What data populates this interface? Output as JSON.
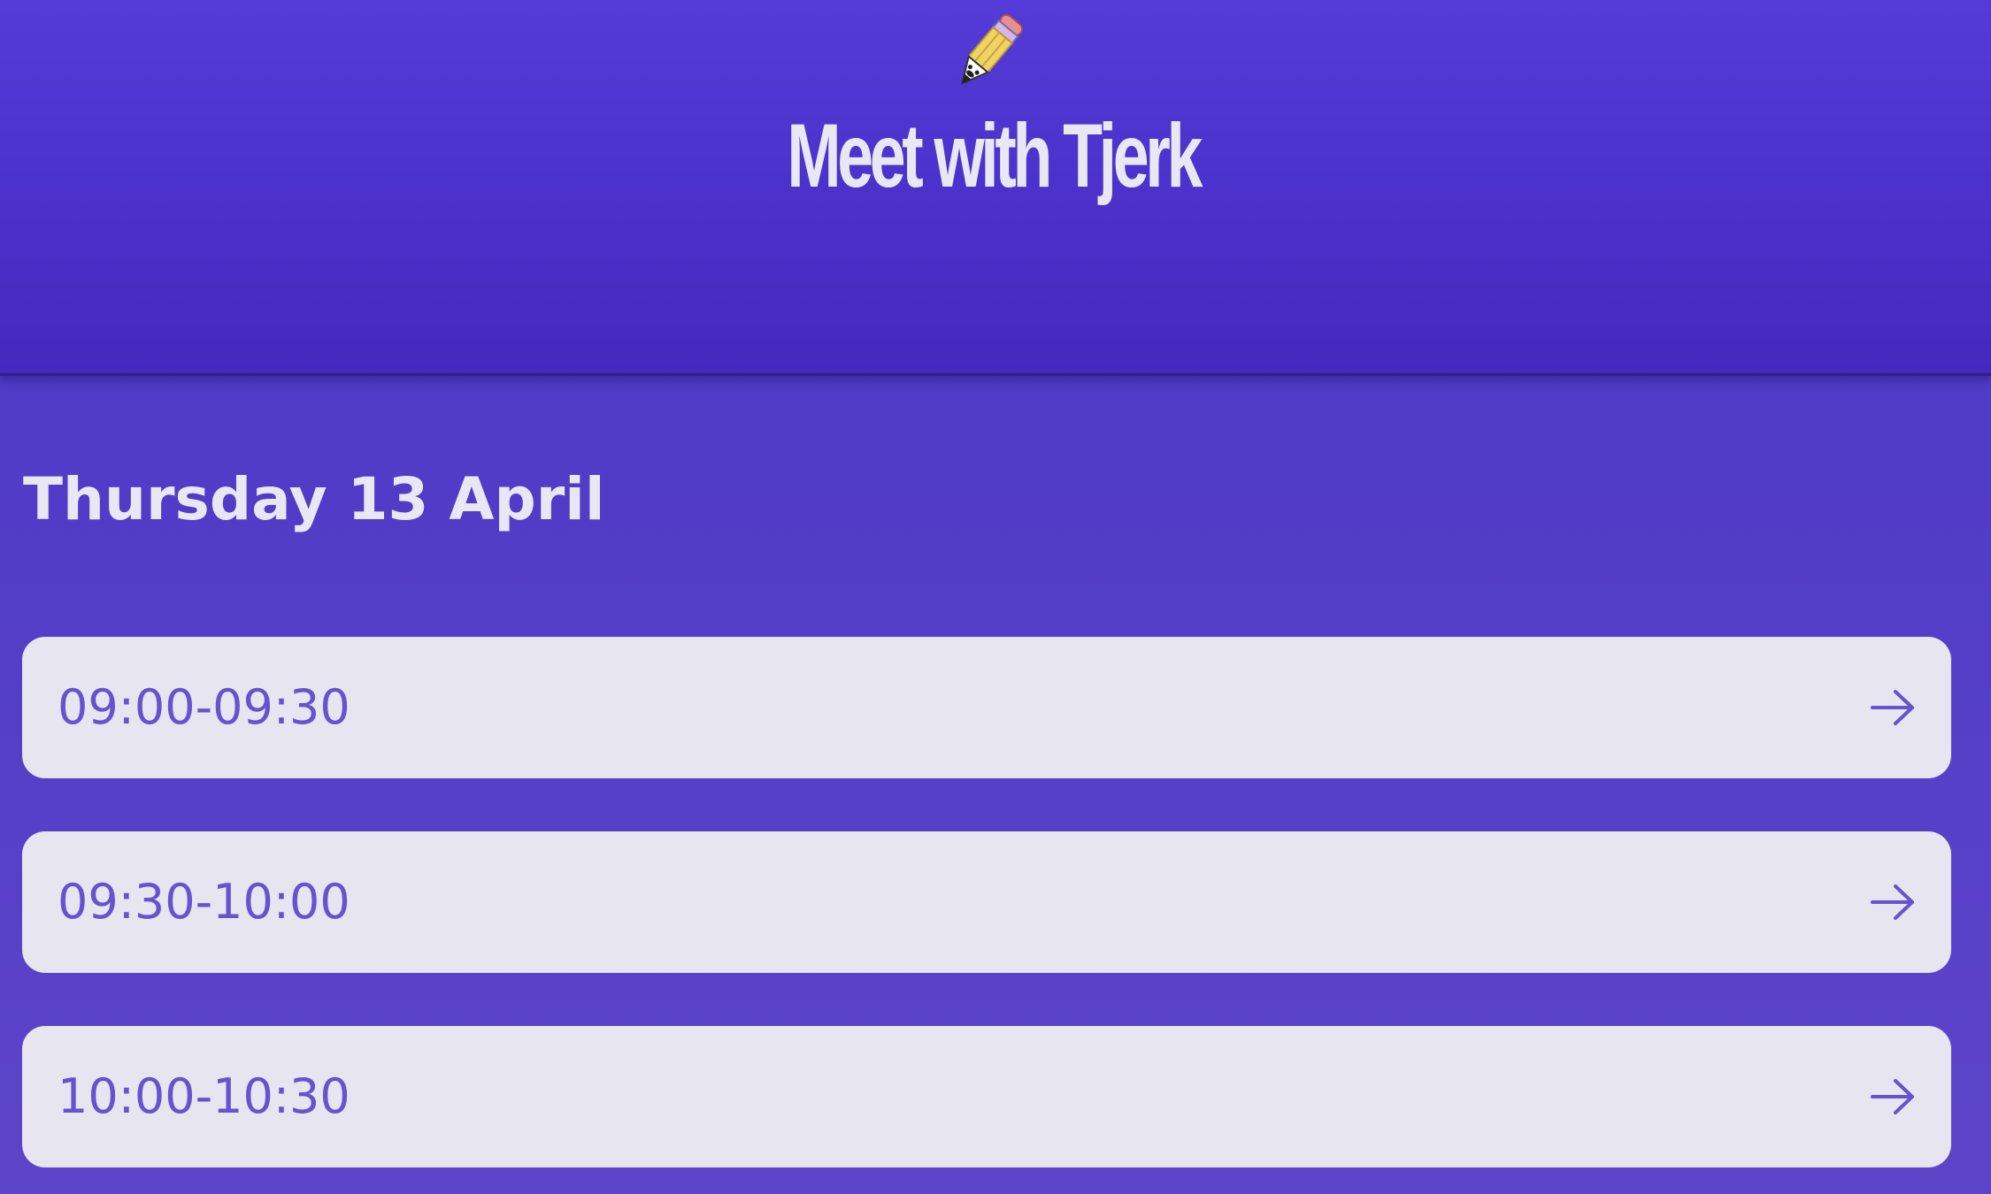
{
  "header": {
    "logo_icon": "pencil-mascot-icon",
    "title": "Meet with Tjerk"
  },
  "schedule": {
    "date": "Thursday 13 April",
    "slots": [
      {
        "label": "09:00-09:30",
        "icon": "arrow-right-icon"
      },
      {
        "label": "09:30-10:00",
        "icon": "arrow-right-icon"
      },
      {
        "label": "10:00-10:30",
        "icon": "arrow-right-icon"
      }
    ]
  },
  "colors": {
    "background": "#4a36c6",
    "header": "#543bd8",
    "slot_background": "#e7e5ef",
    "slot_text": "#6553cf",
    "heading_text": "#e9e7f4"
  }
}
